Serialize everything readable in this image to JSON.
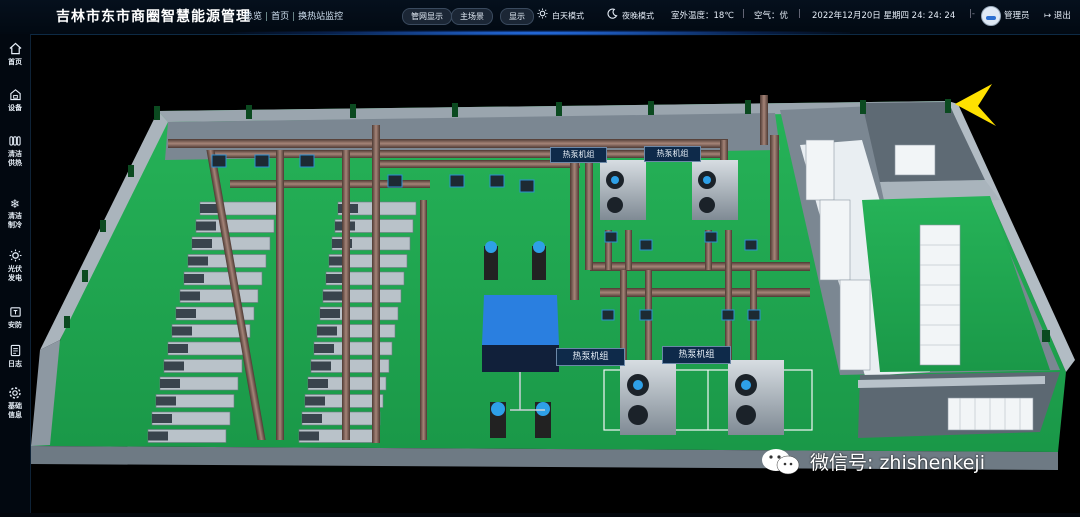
{
  "header": {
    "title": "吉林市东市商圈智慧能源管理",
    "breadcrumbs": [
      "总览",
      "首页",
      "换热站监控"
    ],
    "buttons": [
      "管网显示",
      "主场景",
      "显示"
    ],
    "day_mode": "白天模式",
    "night_mode": "夜晚模式",
    "outdoor_temp": "室外温度：18℃",
    "air_quality": "空气：优",
    "datetime": "2022年12月20日 星期四 24: 24: 24",
    "user": "管理员",
    "logout": "退出"
  },
  "sidebar": {
    "items": [
      {
        "label": "首页",
        "icon": "home-icon"
      },
      {
        "label": "设备",
        "icon": "device-icon"
      },
      {
        "label": "清洁供热",
        "icon": "heating-icon"
      },
      {
        "label": "清洁制冷",
        "icon": "snowflake-icon"
      },
      {
        "label": "光伏发电",
        "icon": "sun-icon"
      },
      {
        "label": "安防",
        "icon": "security-icon"
      },
      {
        "label": "日志",
        "icon": "log-icon"
      },
      {
        "label": "基础信息",
        "icon": "gear-icon"
      }
    ]
  },
  "scene": {
    "labels": [
      "热泵机组",
      "热泵机组",
      "热泵机组",
      "热泵机组"
    ]
  },
  "watermark": "微信号: zhishenkeji",
  "colors": {
    "accent": "#2a7bff",
    "floor": "#1fa84f",
    "pipe": "#7a5c52",
    "wall": "#8e9aa4"
  }
}
